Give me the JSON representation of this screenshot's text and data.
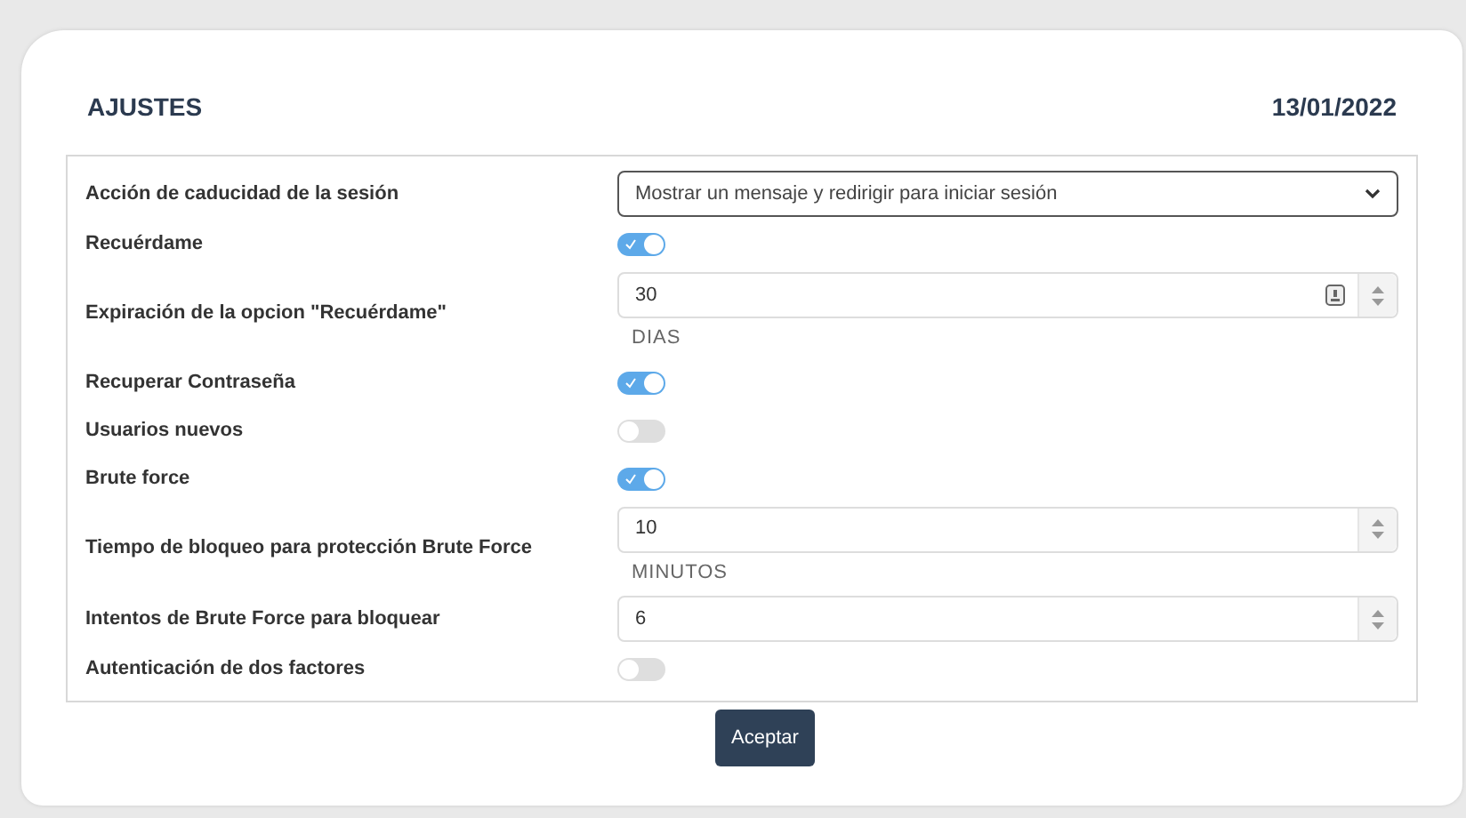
{
  "title": "AJUSTES",
  "date": "13/01/2022",
  "settings": [
    {
      "kind": "select",
      "label": "Acción de caducidad de la sesión",
      "value": "Mostrar un mensaje y redirigir para iniciar sesión"
    },
    {
      "kind": "toggle",
      "label": "Recuérdame",
      "on": true
    },
    {
      "kind": "number",
      "label": "Expiración de la opcion \"Recuérdame\"",
      "value": "30",
      "unit": "DIAS",
      "key_icon": true
    },
    {
      "kind": "toggle",
      "label": "Recuperar Contraseña",
      "on": true
    },
    {
      "kind": "toggle",
      "label": "Usuarios nuevos",
      "on": false
    },
    {
      "kind": "toggle",
      "label": "Brute force",
      "on": true
    },
    {
      "kind": "number",
      "label": "Tiempo de bloqueo para protección Brute Force",
      "value": "10",
      "unit": "MINUTOS",
      "key_icon": false
    },
    {
      "kind": "number",
      "label": "Intentos de Brute Force para bloquear",
      "value": "6",
      "key_icon": false
    },
    {
      "kind": "toggle",
      "label": "Autenticación de dos factores",
      "on": false
    }
  ],
  "submit": "Aceptar"
}
